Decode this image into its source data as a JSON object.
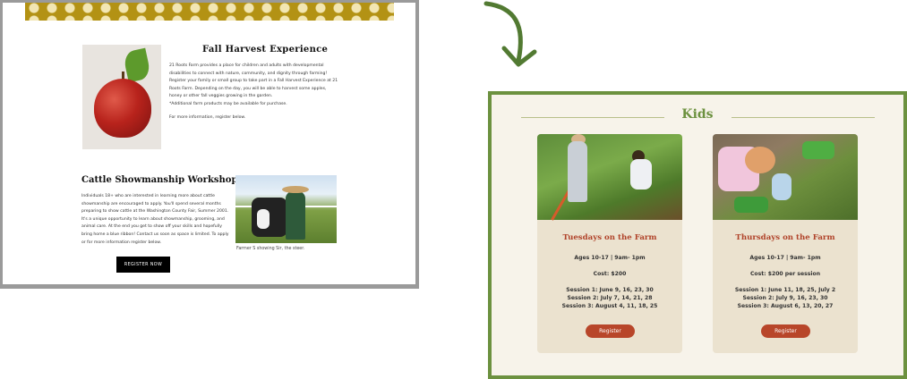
{
  "left_page": {
    "fall": {
      "title": "Fall Harvest Experience",
      "body": "21 Roots Farm provides a place for children and adults with developmental disabilities to connect with nature, community, and dignity through farming! Register your family or small group to take part in a Fall Harvest Experience at 21 Roots Farm. Depending on the day, you will be able to harvest some apples, honey or other fall veggies growing in the garden.",
      "note": "*Additional farm products may be available for purchase.",
      "more": "For more information, register below."
    },
    "cattle": {
      "title": "Cattle Showmanship Workshop",
      "body": "Individuals 18+ who are interested in learning more about cattle showmanship are encouraged to apply. You'll spend several months preparing to show cattle at the Washington County Fair, Summer 2001. It's a unique opportunity to learn about showmanship, grooming, and animal care. At the end you get to show off your skills and hopefully bring home a blue ribbon! Contact us soon as space is limited. To apply or for more information register below.",
      "caption": "Farmer S showing Sir, the steer.",
      "button": "REGISTER NOW"
    }
  },
  "right_page": {
    "heading": "Kids",
    "cards": [
      {
        "title": "Tuesdays on the Farm",
        "ages": "Ages 10-17   |   9am- 1pm",
        "cost": "Cost: $200",
        "session1": "Session 1:  June 9, 16, 23, 30",
        "session2": "Session 2:  July 7, 14, 21, 28",
        "session3": "Session 3: August 4, 11, 18, 25",
        "button": "Register"
      },
      {
        "title": "Thursdays on the Farm",
        "ages": "Ages 10-17  |   9am- 1pm",
        "cost": "Cost: $200 per session",
        "session1": "Session 1: June 11, 18, 25, July 2",
        "session2": "Session 2: July  9, 16, 23, 30",
        "session3": "Session 3: August 6, 13, 20, 27",
        "button": "Register"
      }
    ]
  },
  "colors": {
    "accent_green": "#6c913f",
    "card_title_red": "#b0432a",
    "button_red": "#b8462a"
  },
  "icons": {
    "arrow": "curved-arrow-down-icon"
  }
}
